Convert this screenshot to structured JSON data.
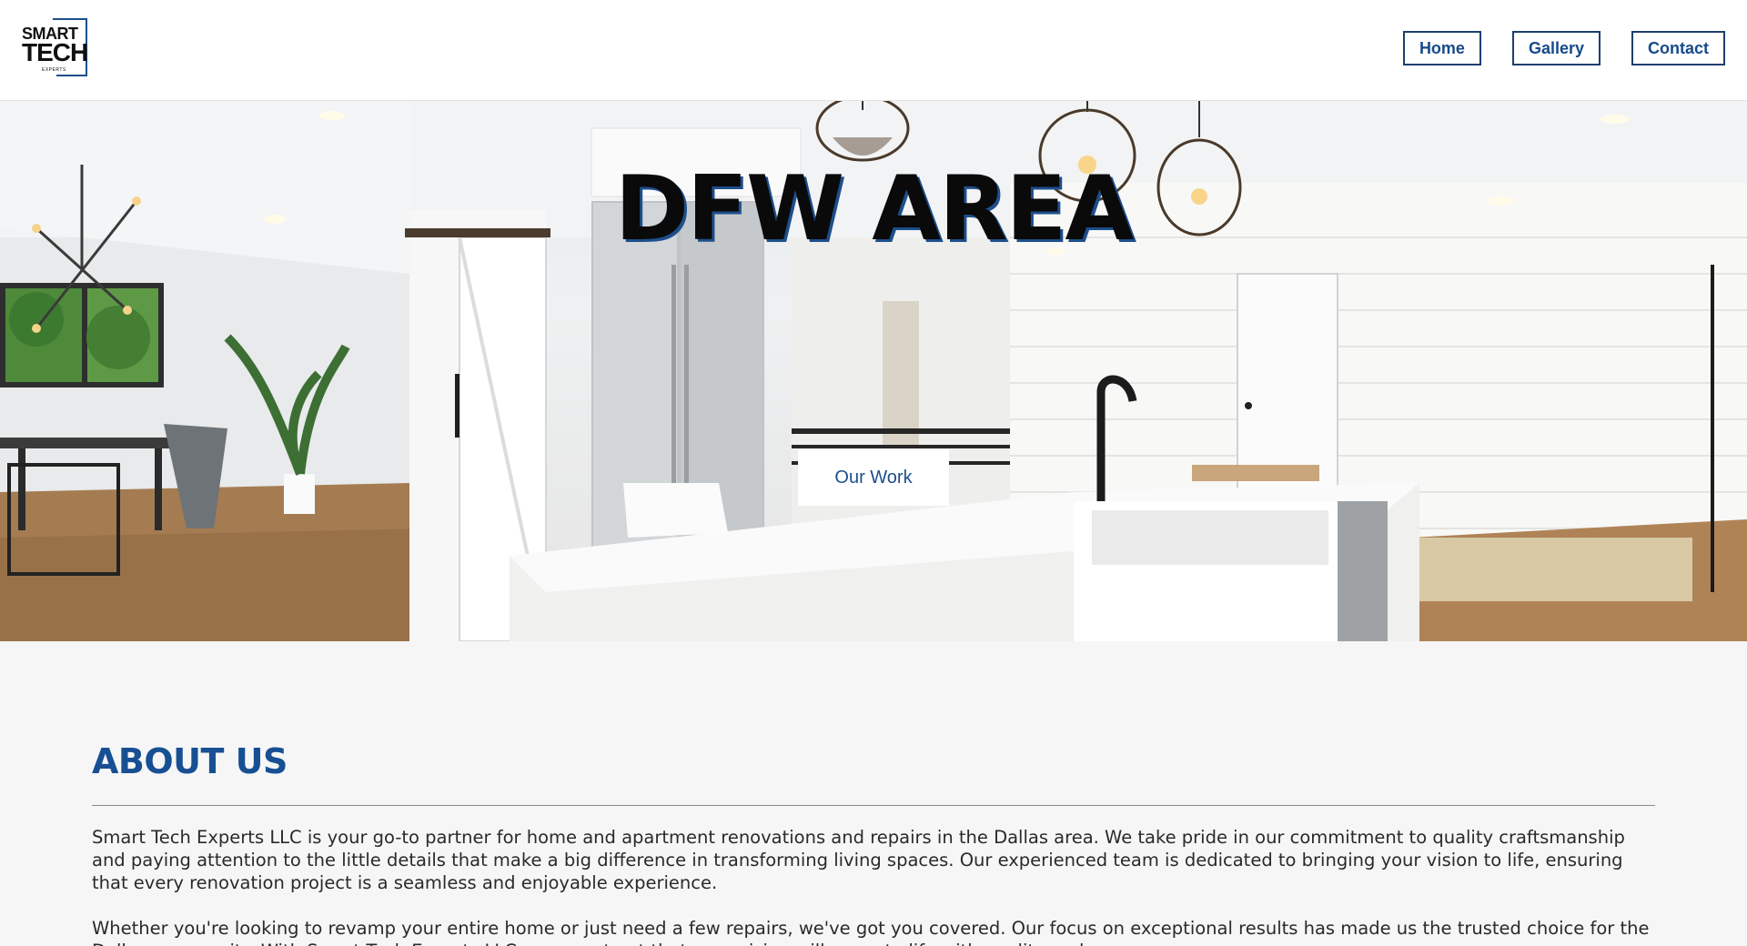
{
  "header": {
    "logo": {
      "line1": "SMART",
      "line2": "TECH",
      "line3": "EXPERTS"
    },
    "nav": [
      {
        "label": "Home"
      },
      {
        "label": "Gallery"
      },
      {
        "label": "Contact"
      }
    ]
  },
  "hero": {
    "title": "DFW AREA",
    "button_label": "Our Work"
  },
  "about": {
    "heading": "ABOUT US",
    "paragraph1": "Smart Tech Experts LLC is your go-to partner for home and apartment renovations and repairs in the Dallas area. We take pride in our commitment to quality craftsmanship and paying attention to the little details that make a big difference in transforming living spaces. Our experienced team is dedicated to bringing your vision to life, ensuring that every renovation project is a seamless and enjoyable experience.",
    "paragraph2": "Whether you're looking to revamp your entire home or just need a few repairs, we've got you covered. Our focus on exceptional results has made us the trusted choice for the Dallas community. With Smart Tech Experts LLC, you can trust that your vision will come to life with quality and care."
  },
  "colors": {
    "brand": "#174f93",
    "header_bg": "#ffffff",
    "page_bg": "#f6f6f6"
  }
}
